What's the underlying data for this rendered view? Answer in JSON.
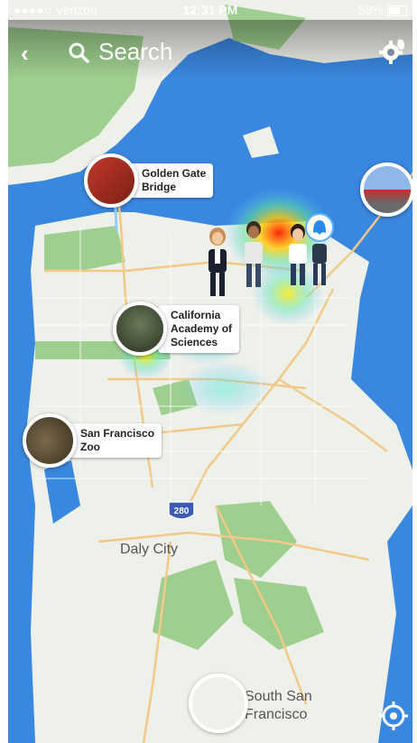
{
  "status": {
    "carrier": "●●●●○ Verizon",
    "time": "12:31 PM",
    "battery": "58%",
    "battery_level": 0.58
  },
  "header": {
    "back_icon": "chevron-left-icon",
    "search_label": "Search",
    "settings_icon": "gear-icon"
  },
  "pois": [
    {
      "name": "Golden Gate Bridge",
      "line1": "Golden Gate",
      "line2": "Bridge",
      "line3": ""
    },
    {
      "name": "California Academy of Sciences",
      "line1": "California",
      "line2": "Academy of",
      "line3": "Sciences"
    },
    {
      "name": "San Francisco Zoo",
      "line1": "San Francisco",
      "line2": "Zoo",
      "line3": ""
    }
  ],
  "places": {
    "daly_city": "Daly City",
    "south_sf_line1": "South San",
    "south_sf_line2": "Francisco"
  },
  "highway": "280",
  "colors": {
    "water": "#3a87e0",
    "land": "#eef0ea",
    "park": "#9fcf8f",
    "road": "#f2c98a",
    "heat": "#ff2a00"
  },
  "controls": {
    "locate_icon": "crosshair-icon"
  }
}
